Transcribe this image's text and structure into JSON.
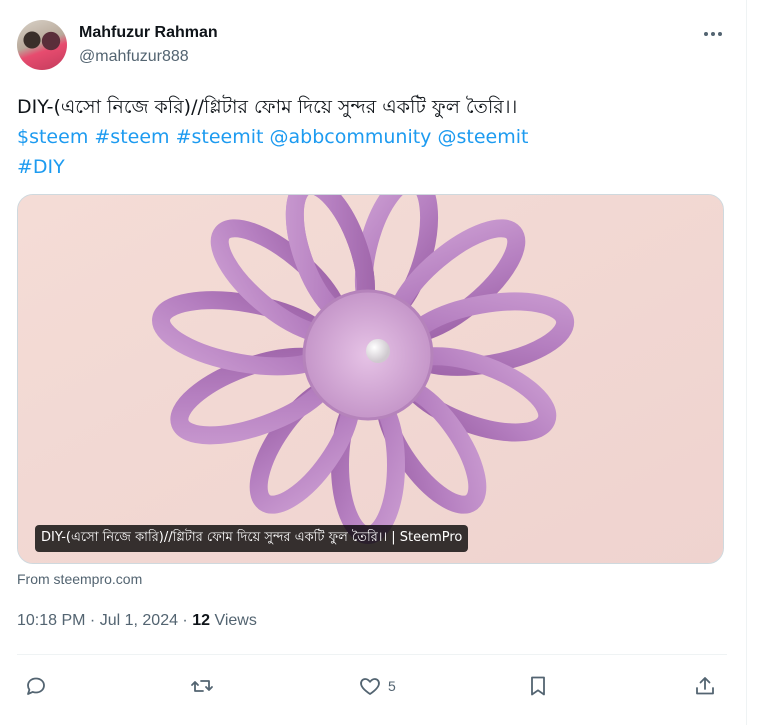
{
  "author": {
    "name": "Mahfuzur Rahman",
    "handle": "@mahfuzur888"
  },
  "tweet": {
    "line1": "DIY-(এসো নিজে করি)//গ্লিটার ফোম দিয়ে সুন্দর একটি ফুল তৈরি।।",
    "tags_line": [
      "$steem",
      "#steem",
      "#steemit",
      "@abbcommunity",
      "@steemit"
    ],
    "tag_last": "#DIY"
  },
  "media": {
    "caption": "DIY-(এসো নিজে কারি)//গ্লিটার ফোম দিয়ে সুন্দর একটি ফুল তৈরি।। | SteemPro"
  },
  "source": "From steempro.com",
  "meta": {
    "time": "10:18 PM",
    "separator": " · ",
    "date": "Jul 1, 2024",
    "views_count": "12",
    "views_label": "Views"
  },
  "actions": {
    "reply_count": "",
    "retweet_count": "",
    "like_count": "5"
  },
  "colors": {
    "link": "#1d9bf0",
    "secondary_text": "#536471",
    "primary_text": "#0f1419"
  }
}
